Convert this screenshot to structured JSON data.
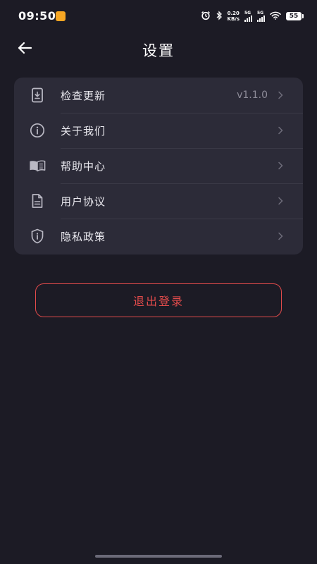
{
  "status_bar": {
    "time": "09:50",
    "net_speed_value": "0.20",
    "net_speed_unit": "KB/s",
    "signal_1_label": "5G",
    "signal_2_label": "5G",
    "battery": "55"
  },
  "header": {
    "title": "设置"
  },
  "settings": {
    "items": [
      {
        "label": "检查更新",
        "value": "v1.1.0",
        "icon": "update-icon"
      },
      {
        "label": "关于我们",
        "icon": "info-icon"
      },
      {
        "label": "帮助中心",
        "icon": "book-icon"
      },
      {
        "label": "用户协议",
        "icon": "document-icon"
      },
      {
        "label": "隐私政策",
        "icon": "shield-icon"
      }
    ]
  },
  "logout": {
    "label": "退出登录",
    "color": "#e24b4b"
  },
  "colors": {
    "background": "#1c1b25",
    "card": "#2c2b38",
    "accent_red": "#e24b4b"
  }
}
